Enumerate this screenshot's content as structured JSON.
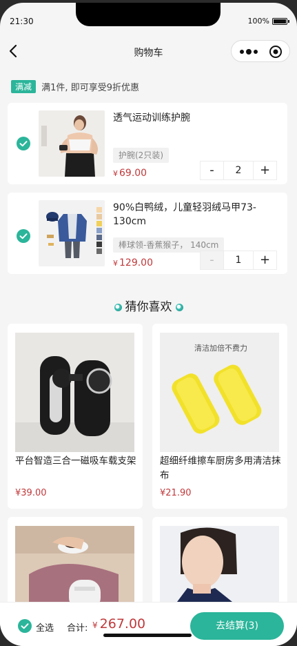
{
  "status_bar": {
    "time": "21:30",
    "battery": "100%"
  },
  "nav": {
    "title": "购物车"
  },
  "promo": {
    "tag": "满减",
    "text": "满1件, 即可享受9折优惠"
  },
  "cart_items": [
    {
      "title": "透气运动训练护腕",
      "spec": "护腕(2只装)",
      "currency": "¥",
      "price": "69.00",
      "quantity": "2",
      "minus": "-",
      "plus": "+"
    },
    {
      "title": "90%白鸭绒，儿童轻羽绒马甲73-130cm",
      "spec": "棒球领-香蕉猴子， 140cm",
      "currency": "¥",
      "price": "129.00",
      "quantity": "1",
      "minus": "-",
      "plus": "+"
    }
  ],
  "recommend": {
    "title": "猜你喜欢",
    "items": [
      {
        "title": "平台智造三合一磁吸车载支架",
        "price": "¥39.00"
      },
      {
        "title": "超细纤维擦车厨房多用清洁抹布",
        "price": "¥21.90",
        "image_caption": "清洁加倍不费力"
      },
      {
        "title": "",
        "price": ""
      },
      {
        "title": "",
        "price": ""
      }
    ]
  },
  "bottom": {
    "select_all": "全选",
    "total_label": "合计:",
    "currency": "¥",
    "total": "267.00",
    "checkout": "去结算(3)"
  },
  "colors": {
    "accent": "#2bb59a",
    "price": "#c0393b",
    "background": "#f5f5f5"
  }
}
